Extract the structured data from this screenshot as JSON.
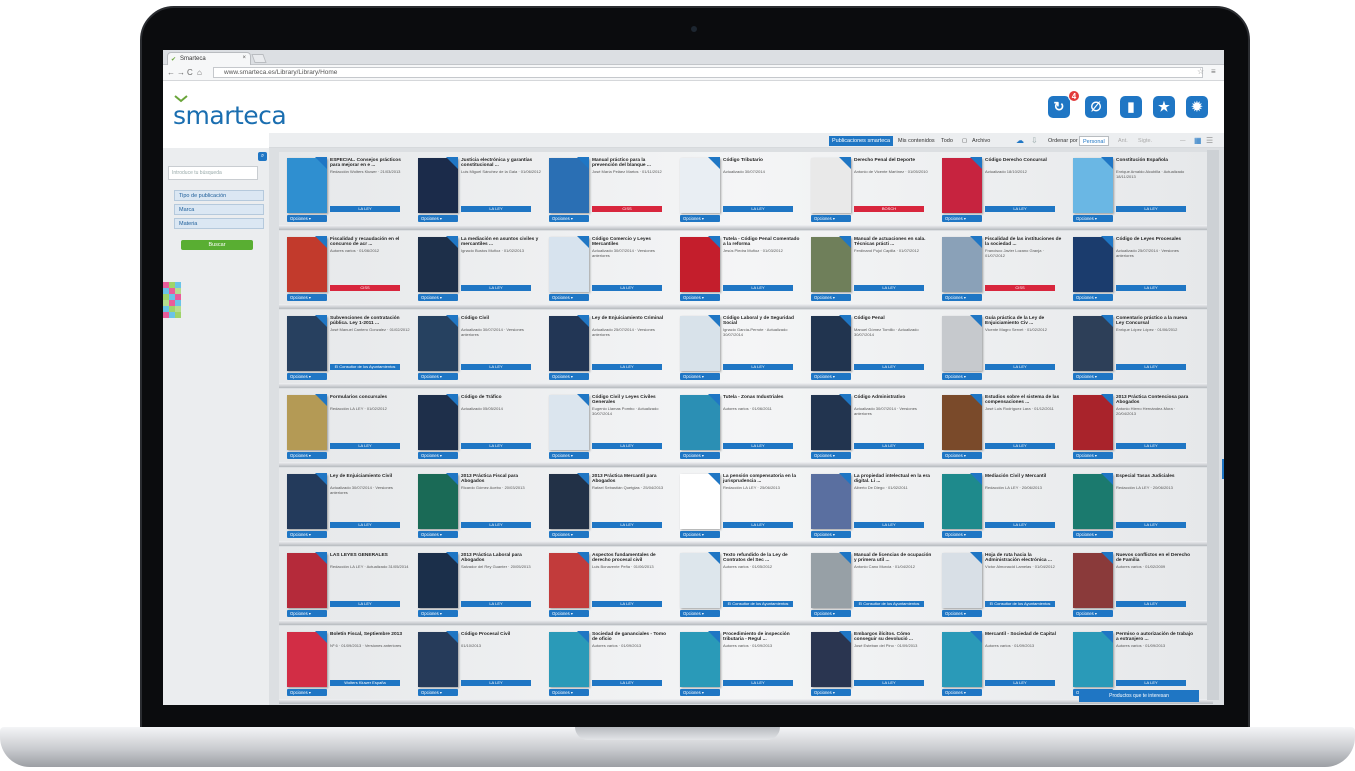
{
  "browser": {
    "tab_title": "Smarteca",
    "url": "www.smarteca.es/Library/Library/Home"
  },
  "app": {
    "logo": "smarteca",
    "notification_count": "4",
    "header_buttons": [
      "sync-icon",
      "clip-icon",
      "bookmark-icon",
      "star-icon",
      "gear-icon"
    ]
  },
  "toolbar": {
    "tab_publicaciones": "Publicaciones smarteca",
    "tab_mis_contenidos": "Mis contenidos",
    "tab_todo": "Todo",
    "archivo": "Archivo",
    "ordenar_label": "Ordenar por",
    "ordenar_value": "Personal",
    "nav_prev": "Ant.",
    "nav_next": "Sigte."
  },
  "sidebar": {
    "search_placeholder": "Introduce tu búsqueda",
    "filters": [
      "Tipo de publicación",
      "Marca",
      "Materia"
    ],
    "buscar_label": "Buscar"
  },
  "shelves": [
    [
      {
        "title": "ESPECIAL. Consejos prácticos para mejorar en e ...",
        "meta": "Redacción Wolters Kluwer · 21/03/2013",
        "label": "LA LEY",
        "color": "#2f8fd0"
      },
      {
        "title": "Justicia electrónica y garantías constitucional ...",
        "meta": "Luis Miguel Sánchez de la Gala · 01/06/2012",
        "label": "LA LEY",
        "color": "#1b2b4a"
      },
      {
        "title": "Manual práctico para la prevención del blanque ...",
        "meta": "José María Peláez Martos · 01/11/2012",
        "label": "CISS",
        "color": "#2a6fb4"
      },
      {
        "title": "Código Tributario",
        "meta": "Actualizado 30/07/2014",
        "label": "LA LEY",
        "color": "#e9eef3"
      },
      {
        "title": "Derecho Penal del Deporte",
        "meta": "Antonio de Vicente Martínez · 01/05/2010",
        "label": "BOSCH",
        "color": "#e9e9e9"
      },
      {
        "title": "Código Derecho Concursal",
        "meta": "Actualizado 18/10/2012",
        "label": "LA LEY",
        "color": "#c7233f"
      },
      {
        "title": "Constitución Española",
        "meta": "Enrique Arnaldo Alcubilla · Actualizado 18/11/2013",
        "label": "LA LEY",
        "color": "#6ab7e4"
      }
    ],
    [
      {
        "title": "Fiscalidad y recaudación en el concurso de acr ...",
        "meta": "Autores varios · 01/06/2012",
        "label": "CISS",
        "color": "#c23a2c"
      },
      {
        "title": "La mediación en asuntos civiles y mercantiles ...",
        "meta": "Ignacio Bustos Muñoz · 01/02/2013",
        "label": "LA LEY",
        "color": "#1d2f49"
      },
      {
        "title": "Código Comercio y Leyes Mercantiles",
        "meta": "Actualizado 30/07/2014 · Versiones anteriores",
        "label": "LA LEY",
        "color": "#d7e3ee"
      },
      {
        "title": "Tutela - Código Penal Comentado a la reforma",
        "meta": "Jesús Piedra Muñoz · 01/03/2012",
        "label": "LA LEY",
        "color": "#c41e2c"
      },
      {
        "title": "Manual de actuaciones en sala. Técnicas prácti ...",
        "meta": "Ferdinand Pujol Capilla · 01/07/2012",
        "label": "LA LEY",
        "color": "#6f7f5a"
      },
      {
        "title": "Fiscalidad de las instituciones de la sociedad ...",
        "meta": "Francisco Javier Lozano Granja · 01/07/2012",
        "label": "CISS",
        "color": "#8aa1b8"
      },
      {
        "title": "Código de Leyes Procesales",
        "meta": "Actualizado 25/07/2014 · Versiones anteriores",
        "label": "LA LEY",
        "color": "#1b3c6d"
      }
    ],
    [
      {
        "title": "Subvenciones de contratación pública. Ley 1-2011 ...",
        "meta": "José Manuel Cantero Gonzalez · 01/02/2012",
        "label": "El Consultor de los Ayuntamientos",
        "color": "#27405f"
      },
      {
        "title": "Código Civil",
        "meta": "Actualizado 30/07/2014 · Versiones anteriores",
        "label": "LA LEY",
        "color": "#264160"
      },
      {
        "title": "Ley de Enjuiciamiento Criminal",
        "meta": "Actualizado 25/07/2014 · Versiones anteriores",
        "label": "LA LEY",
        "color": "#223655"
      },
      {
        "title": "Código Laboral y de Seguridad Social",
        "meta": "Ignacio García-Perrote · Actualizado 30/07/2014",
        "label": "LA LEY",
        "color": "#d8e2ea"
      },
      {
        "title": "Código Penal",
        "meta": "Manuel Gómez Tomillo · Actualizado 30/07/2014",
        "label": "LA LEY",
        "color": "#21344f"
      },
      {
        "title": "Guía práctica de la Ley de Enjuiciamiento Civ ...",
        "meta": "Vicente Magro Servet · 01/02/2012",
        "label": "LA LEY",
        "color": "#c6c9cd"
      },
      {
        "title": "Comentario práctico a la nueva Ley Concursal",
        "meta": "Enrique López López · 01/06/2012",
        "label": "LA LEY",
        "color": "#2d3f58"
      }
    ],
    [
      {
        "title": "Formularios concursales",
        "meta": "Redacción LA LEY · 01/02/2012",
        "label": "LA LEY",
        "color": "#b49a55"
      },
      {
        "title": "Código de Tráfico",
        "meta": "Actualizado 05/05/2014",
        "label": "LA LEY",
        "color": "#1e2f4a"
      },
      {
        "title": "Código Civil y Leyes Civiles Generales",
        "meta": "Eugenio Llamas Pombo · Actualizado 30/07/2014",
        "label": "LA LEY",
        "color": "#dbe5ee"
      },
      {
        "title": "Tutela - Zonas Industriales",
        "meta": "Autores varios · 01/06/2011",
        "label": "LA LEY",
        "color": "#2b8fb4"
      },
      {
        "title": "Código Administrativo",
        "meta": "Actualizado 30/07/2014 · Versiones anteriores",
        "label": "LA LEY",
        "color": "#22344f"
      },
      {
        "title": "Estudios sobre el sistema de las compensaciones ...",
        "meta": "José Luis Rodríguez Lara · 01/12/2011",
        "label": "LA LEY",
        "color": "#7a4a2a"
      },
      {
        "title": "2013 Práctica Contenciosa para Abogados",
        "meta": "Antonio Hierro Hernández-Mora · 20/04/2013",
        "label": "LA LEY",
        "color": "#a9232b"
      }
    ],
    [
      {
        "title": "Ley de Enjuiciamiento Civil",
        "meta": "Actualizado 30/07/2014 · Versiones anteriores",
        "label": "LA LEY",
        "color": "#233a5b"
      },
      {
        "title": "2013 Práctica Fiscal para Abogados",
        "meta": "Ricardo Gómez Acebo · 20/03/2013",
        "label": "LA LEY",
        "color": "#1a6a56"
      },
      {
        "title": "2013 Práctica Mercantil para Abogados",
        "meta": "Rafael Sebastián Quetglas · 25/04/2013",
        "label": "LA LEY",
        "color": "#223147"
      },
      {
        "title": "La pensión compensatoria en la jurisprudencia ...",
        "meta": "Redacción LA LEY · 25/06/2013",
        "label": "LA LEY",
        "color": "#ffffff"
      },
      {
        "title": "La propiedad intelectual en la era digital. Li ...",
        "meta": "Alberto De Diego · 01/02/2011",
        "label": "LA LEY",
        "color": "#5a6fa0"
      },
      {
        "title": "Mediación Civil y Mercantil",
        "meta": "Redacción LA LEY · 20/06/2013",
        "label": "LA LEY",
        "color": "#1e8a8c"
      },
      {
        "title": "Especial Tasas Judiciales",
        "meta": "Redacción LA LEY · 20/06/2013",
        "label": "LA LEY",
        "color": "#1b7a6e"
      }
    ],
    [
      {
        "title": "LAS LEYES GENERALES",
        "meta": "Redacción LA LEY · Actualizado 31/05/2014",
        "label": "LA LEY",
        "color": "#b52a3a"
      },
      {
        "title": "2013 Práctica Laboral para Abogados",
        "meta": "Salvador del Rey Guanter · 20/05/2013",
        "label": "LA LEY",
        "color": "#1b2f4a"
      },
      {
        "title": "Aspectos fundamentales de derecho procesal civil",
        "meta": "Luis Bonavente Peña · 01/06/2013",
        "label": "LA LEY",
        "color": "#c23b3b"
      },
      {
        "title": "Texto refundido de la Ley de Contratos del Sec ...",
        "meta": "Autores varios · 01/05/2012",
        "label": "El Consultor de los Ayuntamientos",
        "color": "#dde6ec"
      },
      {
        "title": "Manual de licencias de ocupación y primera util ...",
        "meta": "Antonio Cano Murcia · 01/04/2012",
        "label": "El Consultor de los Ayuntamientos",
        "color": "#97a0a6"
      },
      {
        "title": "Hoja de ruta hacia la Administración electrónica ...",
        "meta": "Víctor Almonacid Lamelas · 01/04/2012",
        "label": "El Consultor de los Ayuntamientos",
        "color": "#d8dfe6"
      },
      {
        "title": "Nuevos conflictos en el Derecho de Familia",
        "meta": "Autores varios · 01/02/2009",
        "label": "LA LEY",
        "color": "#8a3a3a"
      }
    ],
    [
      {
        "title": "Boletín Fiscal, Septiembre 2013",
        "meta": "Nº 6 · 01/09/2013 · Versiones anteriores",
        "label": "Wolters Kluwer España",
        "color": "#d22d45"
      },
      {
        "title": "Código Procesal Civil",
        "meta": "01/10/2013",
        "label": "LA LEY",
        "color": "#263b5a"
      },
      {
        "title": "Sociedad de gananciales - Tomo de oficio",
        "meta": "Autores varios · 01/09/2013",
        "label": "LA LEY",
        "color": "#2a9ab8"
      },
      {
        "title": "Procedimiento de inspección tributaria - Regul ...",
        "meta": "Autores varios · 01/09/2013",
        "label": "LA LEY",
        "color": "#2a9ab8"
      },
      {
        "title": "Embargos ilícitos. Cómo conseguir su devolució ...",
        "meta": "José Esteban del Pino · 01/09/2013",
        "label": "LA LEY",
        "color": "#2a3550"
      },
      {
        "title": "Mercantil - Sociedad de Capital",
        "meta": "Autores varios · 01/09/2013",
        "label": "LA LEY",
        "color": "#2a9ab8"
      },
      {
        "title": "Permiso o autorización de trabajo a extranjero ...",
        "meta": "Autores varios · 01/09/2013",
        "label": "LA LEY",
        "color": "#2a9ab8"
      }
    ]
  ],
  "options_label": "Opciones",
  "bottom_button": "Productos que te interesan"
}
